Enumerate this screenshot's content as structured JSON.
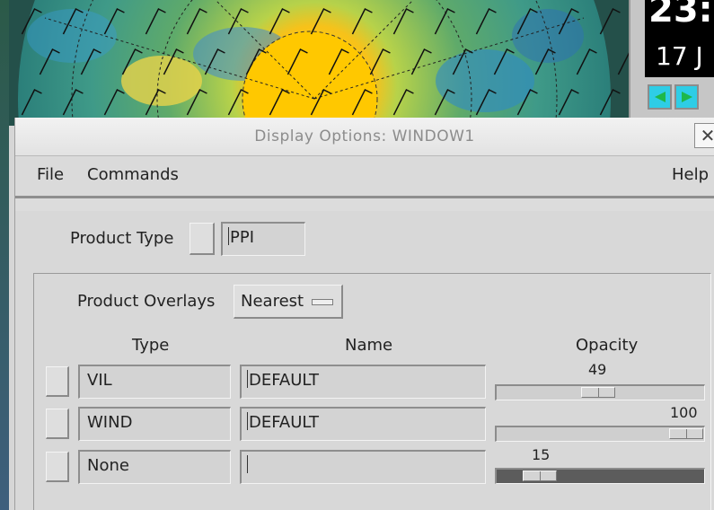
{
  "clock": {
    "time": "23:",
    "date": "17 J"
  },
  "dialog": {
    "title": "Display Options:  WINDOW1",
    "close_glyph": "✕",
    "menu": {
      "file": "File",
      "commands": "Commands",
      "help": "Help"
    },
    "product_type": {
      "label": "Product Type",
      "value": "PPI"
    },
    "product_overlays": {
      "label": "Product Overlays",
      "selected": "Nearest"
    },
    "columns": {
      "type": "Type",
      "name": "Name",
      "opacity": "Opacity"
    },
    "overlays": [
      {
        "type": "VIL",
        "name": "DEFAULT",
        "opacity": 49,
        "opacity_label": "49"
      },
      {
        "type": "WIND",
        "name": "DEFAULT",
        "opacity": 100,
        "opacity_label": "100"
      },
      {
        "type": "None",
        "name": "",
        "opacity": 15,
        "opacity_label": "15"
      }
    ]
  },
  "icons": {
    "close": "close-icon",
    "prev": "arrow-left-icon",
    "next": "arrow-right-icon",
    "option_menu": "option-menu-indicator-icon"
  },
  "colors": {
    "nav_button": "#2ecde6",
    "nav_arrow": "#1db84a",
    "radar_bright": "#ffd21a"
  }
}
